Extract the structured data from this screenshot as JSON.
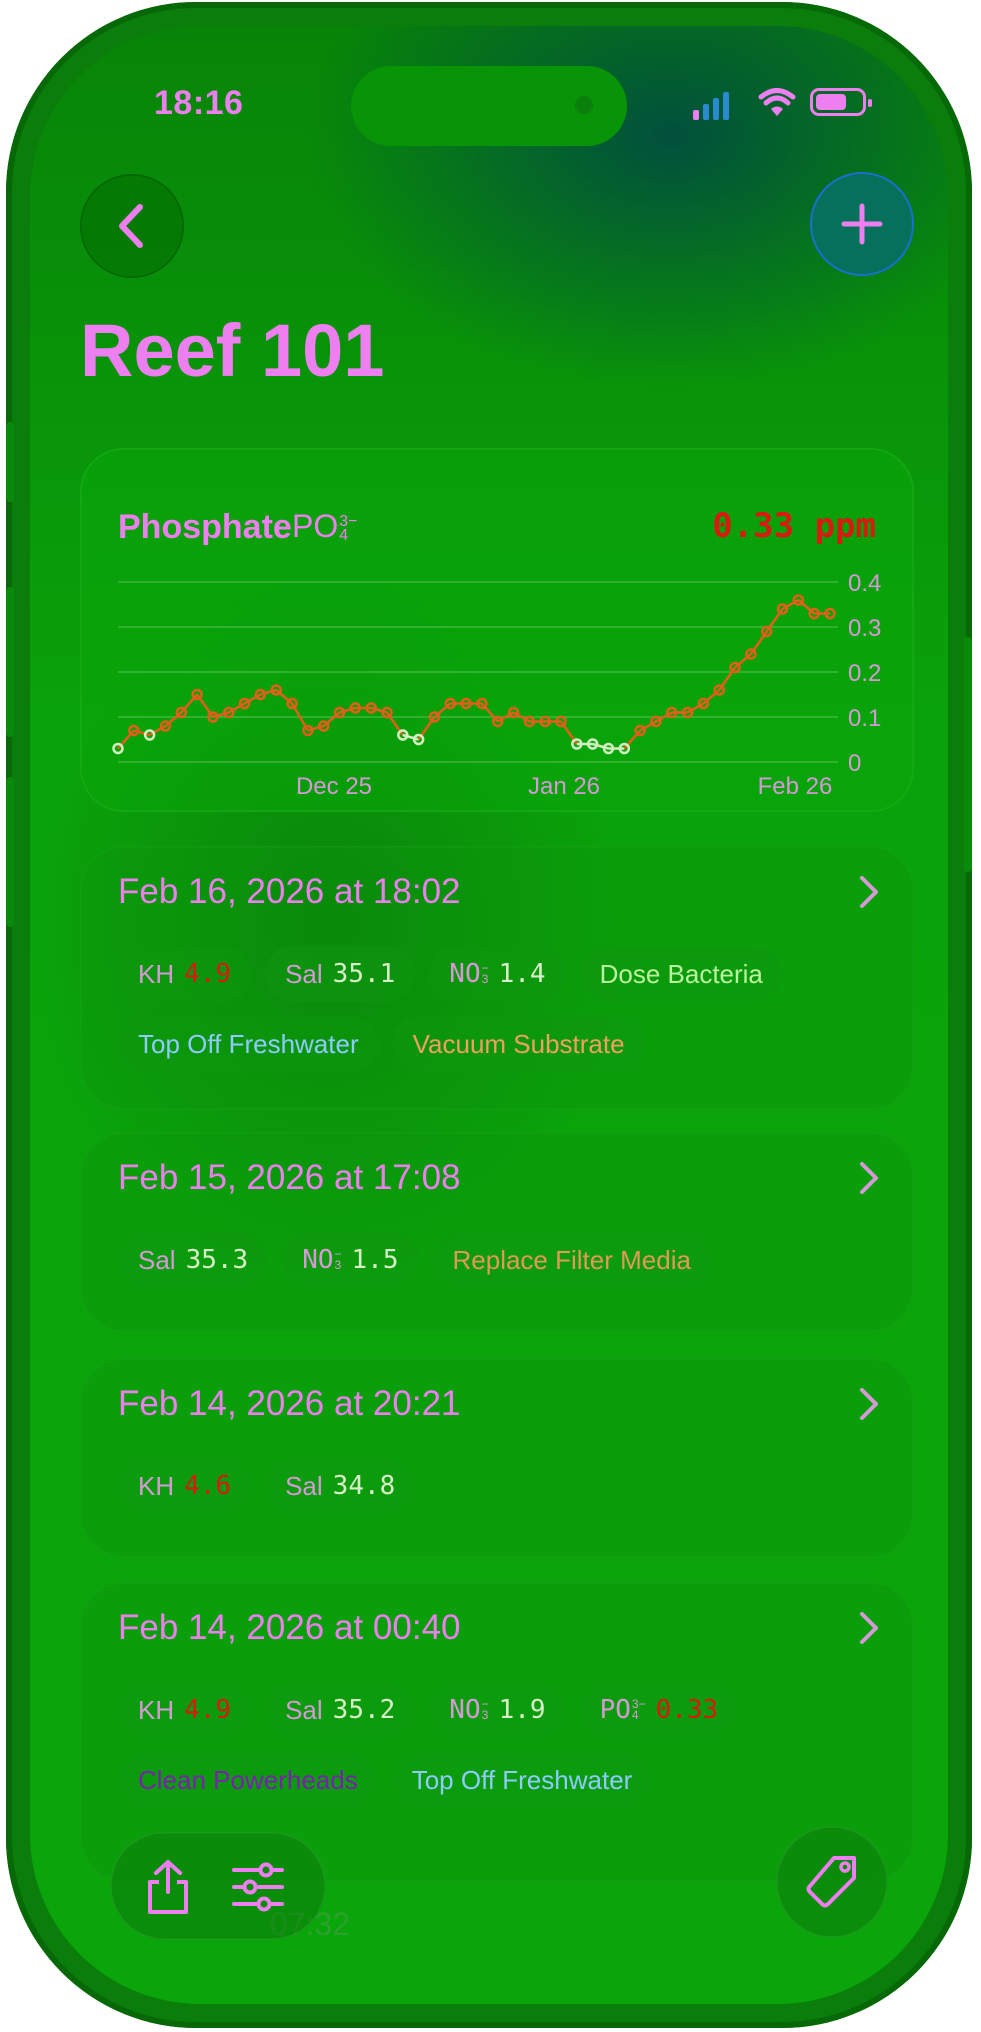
{
  "status_bar": {
    "time": "18:16"
  },
  "header": {
    "title": "Reef 101"
  },
  "chart_card": {
    "parameter": "Phosphate",
    "formula_base": "PO",
    "formula_sup": "3−",
    "formula_sub": "4",
    "current_value": "0.33 ppm",
    "colors": {
      "in_range": "#d0f0c0",
      "out_of_range": "#e0601a",
      "value_text": "#d81a10"
    }
  },
  "chart_data": {
    "type": "line",
    "title": "",
    "xlabel": "",
    "ylabel": "",
    "ylim": [
      0,
      0.4
    ],
    "y_ticks": [
      "0.4",
      "0.3",
      "0.2",
      "0.1",
      "0"
    ],
    "x_ticks": [
      "Dec 25",
      "Jan 26",
      "Feb 26"
    ],
    "grid": true,
    "series": [
      {
        "values": [
          0.03,
          0.07,
          0.06,
          0.08,
          0.11,
          0.15,
          0.1,
          0.11,
          0.13,
          0.15,
          0.16,
          0.13,
          0.07,
          0.08,
          0.11,
          0.12,
          0.12,
          0.11,
          0.06,
          0.05,
          0.1,
          0.13,
          0.13,
          0.13,
          0.09,
          0.11,
          0.09,
          0.09,
          0.09,
          0.04,
          0.04,
          0.03,
          0.03,
          0.07,
          0.09,
          0.11,
          0.11,
          0.13,
          0.16,
          0.21,
          0.24,
          0.29,
          0.34,
          0.36,
          0.33,
          0.33
        ]
      }
    ]
  },
  "entries": [
    {
      "date": "Feb 16, 2026 at 18:02",
      "params": [
        {
          "label": "KH",
          "value": "4.9",
          "color": "#d81a10"
        },
        {
          "label": "Sal",
          "value": "35.1",
          "color": "#d8f0c8"
        },
        {
          "label": "NO",
          "sup": "−",
          "sub": "3",
          "value": "1.4",
          "color": "#d8f0c8"
        }
      ],
      "actions": [
        {
          "label": "Dose Bacteria",
          "color": "#b8f4a0"
        },
        {
          "label": "Top Off Freshwater",
          "color": "#8ecbff"
        },
        {
          "label": "Vacuum Substrate",
          "color": "#f0a060"
        }
      ]
    },
    {
      "date": "Feb 15, 2026 at 17:08",
      "params": [
        {
          "label": "Sal",
          "value": "35.3",
          "color": "#d8f0c8"
        },
        {
          "label": "NO",
          "sup": "−",
          "sub": "3",
          "value": "1.5",
          "color": "#d8f0c8"
        }
      ],
      "actions": [
        {
          "label": "Replace Filter Media",
          "color": "#e09a58"
        }
      ]
    },
    {
      "date": "Feb 14, 2026 at 20:21",
      "params": [
        {
          "label": "KH",
          "value": "4.6",
          "color": "#d81a10"
        },
        {
          "label": "Sal",
          "value": "34.8",
          "color": "#d8f0c8"
        }
      ],
      "actions": []
    },
    {
      "date": "Feb 14, 2026 at 00:40",
      "params": [
        {
          "label": "KH",
          "value": "4.9",
          "color": "#d81a10"
        },
        {
          "label": "Sal",
          "value": "35.2",
          "color": "#d8f0c8"
        },
        {
          "label": "NO",
          "sup": "−",
          "sub": "3",
          "value": "1.9",
          "color": "#d8f0c8"
        },
        {
          "label": "PO",
          "sup": "3−",
          "sub": "4",
          "value": "0.33",
          "color": "#d81a10"
        }
      ],
      "actions": [
        {
          "label": "Clean Powerheads",
          "color": "#7a20b0"
        },
        {
          "label": "Top Off Freshwater",
          "color": "#8ecbff"
        }
      ]
    }
  ],
  "ghost": "07:32",
  "colors": {
    "accent": "#ee7ff0",
    "background": "#0aa50a"
  }
}
